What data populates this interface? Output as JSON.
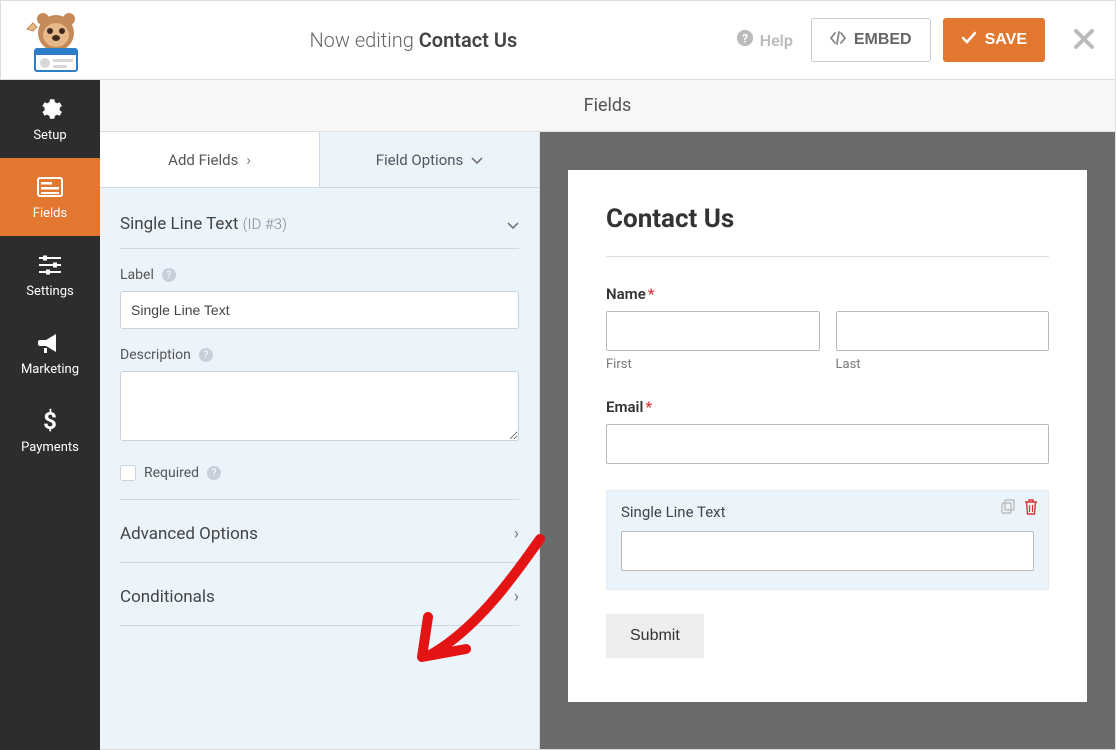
{
  "topbar": {
    "editing_prefix": "Now editing ",
    "form_name": "Contact Us",
    "help": "Help",
    "embed": "EMBED",
    "save": "SAVE"
  },
  "leftnav": {
    "setup": "Setup",
    "fields": "Fields",
    "settings": "Settings",
    "marketing": "Marketing",
    "payments": "Payments"
  },
  "header": {
    "title": "Fields"
  },
  "panel": {
    "tab_add": "Add Fields",
    "tab_options": "Field Options",
    "section": {
      "title": "Single Line Text",
      "id_label": "(ID #3)"
    },
    "label_label": "Label",
    "label_value": "Single Line Text",
    "description_label": "Description",
    "description_value": "",
    "required_label": "Required",
    "advanced_label": "Advanced Options",
    "conditionals_label": "Conditionals"
  },
  "preview": {
    "title": "Contact Us",
    "name_label": "Name",
    "first_label": "First",
    "last_label": "Last",
    "email_label": "Email",
    "slt_label": "Single Line Text",
    "submit": "Submit"
  }
}
